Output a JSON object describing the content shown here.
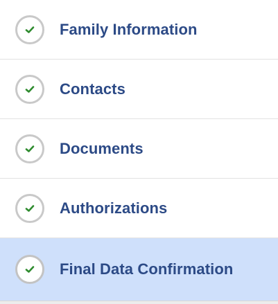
{
  "steps": [
    {
      "label": "Family Information",
      "status": "complete",
      "icon": "check-icon",
      "active": false
    },
    {
      "label": "Contacts",
      "status": "complete",
      "icon": "check-icon",
      "active": false
    },
    {
      "label": "Documents",
      "status": "complete",
      "icon": "check-icon",
      "active": false
    },
    {
      "label": "Authorizations",
      "status": "complete",
      "icon": "check-icon",
      "active": false
    },
    {
      "label": "Final Data Confirmation",
      "status": "complete",
      "icon": "check-icon",
      "active": true
    }
  ],
  "colors": {
    "label": "#2c4a86",
    "check": "#2e8b2e",
    "circle_border": "#c9c9c9",
    "active_background": "#cfe0fb",
    "divider": "#e2e2e2"
  }
}
